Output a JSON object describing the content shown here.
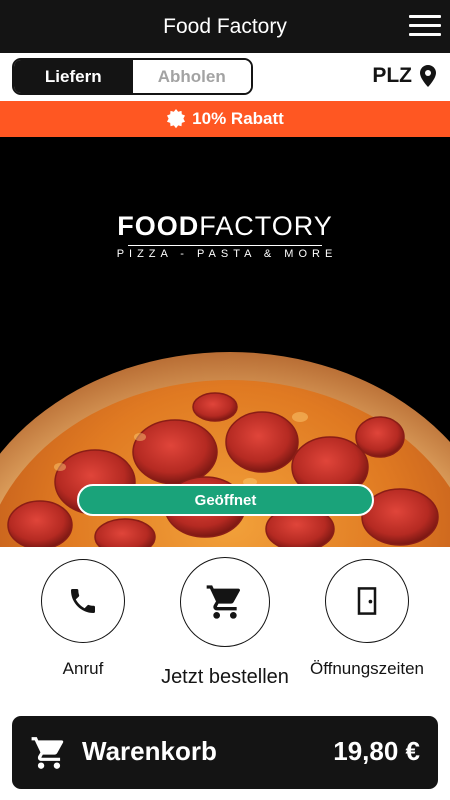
{
  "header": {
    "title": "Food Factory",
    "menu_icon": "hamburger-menu-icon"
  },
  "order_mode": {
    "options": [
      {
        "label": "Liefern",
        "active": true
      },
      {
        "label": "Abholen",
        "active": false
      }
    ]
  },
  "postcode": {
    "label": "PLZ",
    "icon": "location-pin-icon"
  },
  "promo": {
    "text": "10% Rabatt",
    "icon": "badge-icon"
  },
  "hero": {
    "logo_word_bold": "FOOD",
    "logo_word_light": "FACTORY",
    "logo_tagline": "PIZZA - PASTA & MORE",
    "status_label": "Geöffnet"
  },
  "actions": [
    {
      "label": "Anruf",
      "icon": "phone-icon"
    },
    {
      "label": "Jetzt bestellen",
      "icon": "cart-icon"
    },
    {
      "label": "Öffnungszeiten",
      "icon": "door-icon"
    }
  ],
  "cart": {
    "label": "Warenkorb",
    "amount": "19,80 €",
    "icon": "cart-icon"
  },
  "colors": {
    "dark": "#141414",
    "accent_orange": "#ff5722",
    "status_green": "#1aa37a",
    "inactive_text": "#a3a3a3"
  }
}
